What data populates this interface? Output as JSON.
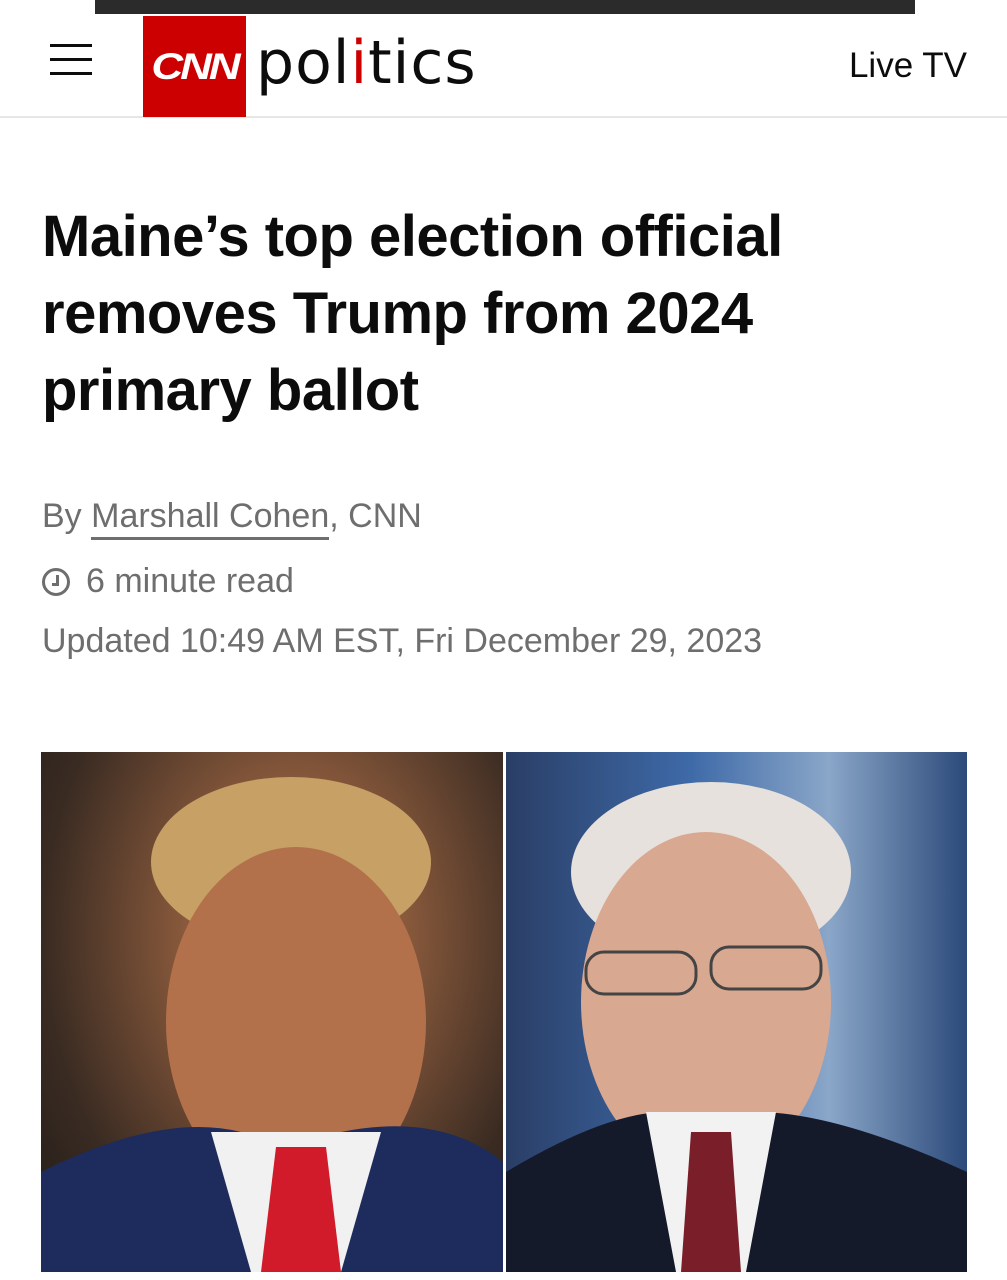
{
  "header": {
    "logo_text": "CNN",
    "section_pre": "pol",
    "section_accent": "i",
    "section_post": "tics",
    "live_tv": "Live TV"
  },
  "article": {
    "headline": "Maine’s top election official removes Trump from 2024 primary ballot",
    "byline_prefix": "By ",
    "author": "Marshall Cohen",
    "byline_suffix": ", CNN",
    "read_time": "6 minute read",
    "updated": "Updated 10:49 AM EST, Fri December 29, 2023"
  },
  "colors": {
    "brand_red": "#cc0000",
    "text": "#0c0c0c",
    "meta_gray": "#6e6e6e"
  },
  "icons": {
    "menu": "hamburger-menu-icon",
    "clock": "clock-icon"
  }
}
